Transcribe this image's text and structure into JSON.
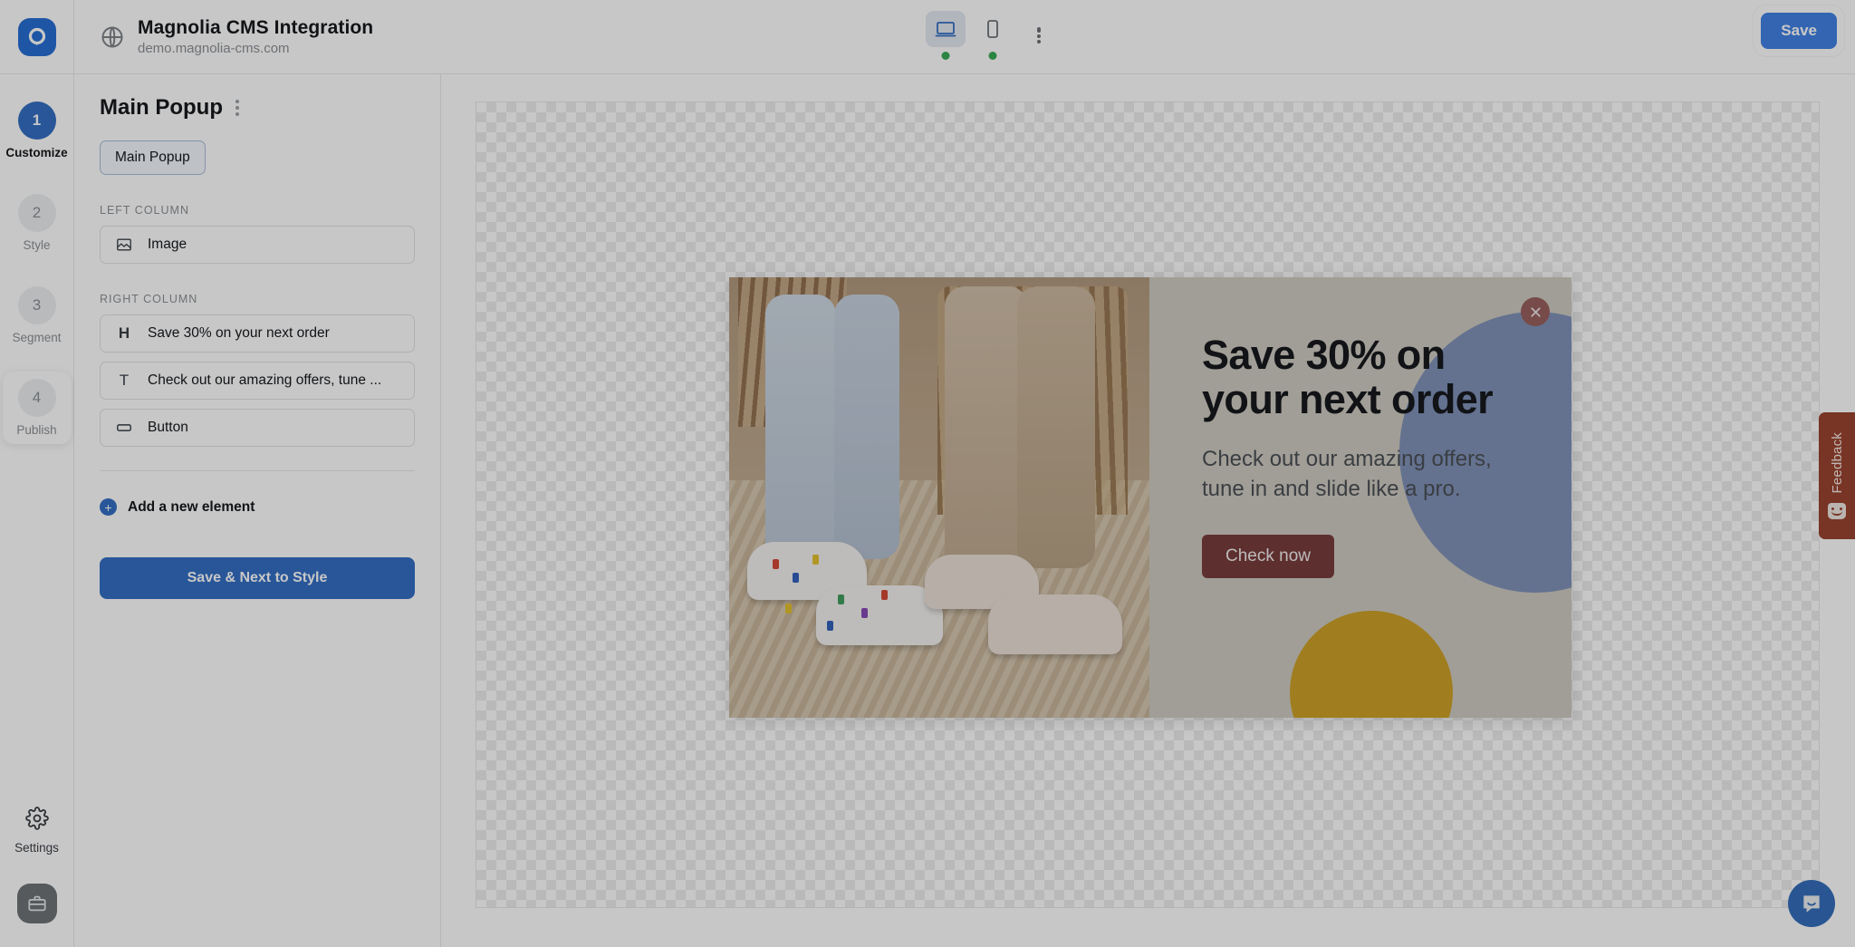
{
  "topbar": {
    "logo_icon": "unbounce-logo-icon",
    "globe_icon": "globe-icon",
    "site_title": "Magnolia CMS Integration",
    "site_url": "demo.magnolia-cms.com",
    "device_desktop_icon": "desktop-icon",
    "device_mobile_icon": "mobile-icon",
    "more_icon": "kebab-menu-icon",
    "save_label": "Save",
    "accent_blue": "#3b82f0",
    "status_dot_color": "#2fae4e"
  },
  "rail": {
    "steps": [
      {
        "number": "1",
        "label": "Customize",
        "state": "active"
      },
      {
        "number": "2",
        "label": "Style",
        "state": "pending"
      },
      {
        "number": "3",
        "label": "Segment",
        "state": "pending"
      },
      {
        "number": "4",
        "label": "Publish",
        "state": "current"
      }
    ],
    "settings_label": "Settings",
    "settings_icon": "gear-icon",
    "briefcase_icon": "briefcase-icon"
  },
  "panel": {
    "title": "Main Popup",
    "kebab_icon": "kebab-menu-icon",
    "target_icon": "target-radio-icon",
    "plus_icon": "plus-circle-icon",
    "chip_label": "Main Popup",
    "sections": [
      {
        "label": "LEFT COLUMN",
        "elements": [
          {
            "icon": "image-icon",
            "glyph": "image",
            "label": "Image"
          }
        ]
      },
      {
        "label": "RIGHT COLUMN",
        "elements": [
          {
            "icon": "heading-icon",
            "glyph": "H",
            "label": "Save 30% on your next order"
          },
          {
            "icon": "text-icon",
            "glyph": "T",
            "label": "Check out our amazing offers, tune ..."
          },
          {
            "icon": "button-icon",
            "glyph": "button",
            "label": "Button"
          }
        ]
      }
    ],
    "add_element_label": "Add a new element",
    "primary_button_label": "Save & Next to Style"
  },
  "canvas": {
    "popup": {
      "close_icon": "close-icon",
      "heading": "Save 30% on your next order",
      "paragraph": "Check out our amazing offers, tune in and slide like a pro.",
      "cta_label": "Check now",
      "background_color": "#cfcbc0",
      "cta_color": "#7e3b3b",
      "blob_blue_color": "#7f92bd",
      "blob_gold_color": "#d2a019"
    }
  },
  "feedback": {
    "label": "Feedback",
    "icon": "smiley-face-icon",
    "color": "#a2412a"
  },
  "chat": {
    "icon": "chat-bubble-icon",
    "color": "#2f6fc4"
  }
}
